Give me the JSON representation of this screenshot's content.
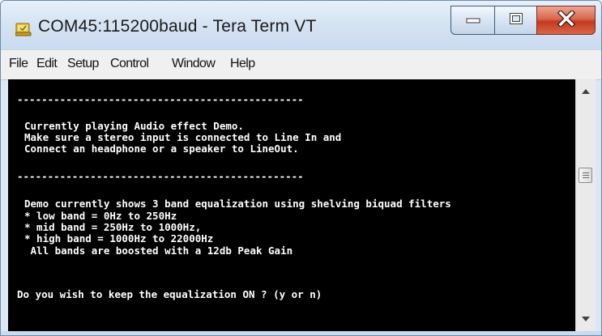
{
  "window": {
    "title": "COM45:115200baud - Tera Term VT",
    "app_icon": "tera-term-icon"
  },
  "caption_buttons": {
    "minimize_icon": "minimize-icon",
    "maximize_icon": "maximize-icon",
    "close_icon": "close-icon",
    "close_color": "#c3391f"
  },
  "menu": {
    "items": [
      {
        "label": "File"
      },
      {
        "label": "Edit"
      },
      {
        "label": "Setup"
      },
      {
        "label": "Control"
      },
      {
        "label": "Window"
      },
      {
        "label": "Help"
      }
    ]
  },
  "terminal": {
    "background": "#000000",
    "foreground": "#ffffff",
    "lines": [
      "-----------------------------------------------",
      "Currently playing Audio effect Demo.",
      "Make sure a stereo input is connected to Line In and",
      "Connect an headphone or a speaker to LineOut.",
      "-----------------------------------------------",
      "Demo currently shows 3 band equalization using shelving biquad filters",
      "* low band = 0Hz to 250Hz",
      "* mid band = 250Hz to 1000Hz,",
      "* high band = 1000Hz to 22000Hz",
      " All bands are boosted with a 12db Peak Gain",
      "Do you wish to keep the equalization ON ? (y or n)"
    ]
  },
  "scrollbar": {
    "up_icon": "scroll-up-arrow-icon",
    "down_icon": "scroll-down-arrow-icon"
  }
}
